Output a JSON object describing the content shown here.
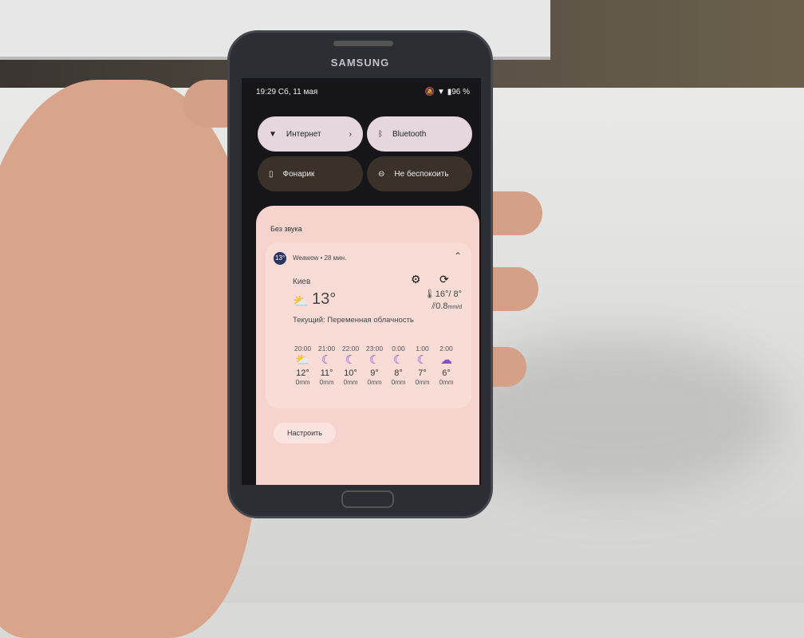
{
  "device": {
    "brand": "SAMSUNG"
  },
  "status_bar": {
    "time_date": "19:29 Сб, 11 мая",
    "battery": "96 %",
    "icons": [
      "mute-icon",
      "wifi-icon",
      "battery-icon"
    ]
  },
  "quick_tiles": [
    {
      "label": "Интернет",
      "icon": "wifi-icon",
      "active": true,
      "has_chevron": true
    },
    {
      "label": "Bluetooth",
      "icon": "bluetooth-icon",
      "active": true
    },
    {
      "label": "Фонарик",
      "icon": "flashlight-icon",
      "active": false
    },
    {
      "label": "Не беспокоить",
      "icon": "do-not-disturb-icon",
      "active": false
    }
  ],
  "notifications": {
    "section": "Без звука",
    "app_icon_text": "13°",
    "app": "Weawow • 28 мин.",
    "city": "Киев",
    "current_temp": "13°",
    "high_low": "16°/ 8°",
    "precip": "0.8",
    "precip_unit": "mm/d",
    "condition": "Текущий: Переменная облачность",
    "hourly": [
      {
        "time": "20:00",
        "icon": "sun-cloud-icon",
        "temp": "12°",
        "precip": "0",
        "unit": "mm"
      },
      {
        "time": "21:00",
        "icon": "moon-icon",
        "temp": "11°",
        "precip": "0",
        "unit": "mm"
      },
      {
        "time": "22:00",
        "icon": "moon-icon",
        "temp": "10°",
        "precip": "0",
        "unit": "mm"
      },
      {
        "time": "23:00",
        "icon": "moon-icon",
        "temp": "9°",
        "precip": "0",
        "unit": "mm"
      },
      {
        "time": "0:00",
        "icon": "moon-icon",
        "temp": "8°",
        "precip": "0",
        "unit": "mm"
      },
      {
        "time": "1:00",
        "icon": "moon-icon",
        "temp": "7°",
        "precip": "0",
        "unit": "mm"
      },
      {
        "time": "2:00",
        "icon": "moon-cloud-icon",
        "temp": "6°",
        "precip": "0",
        "unit": "mm"
      }
    ],
    "settings_button": "Настроить"
  }
}
